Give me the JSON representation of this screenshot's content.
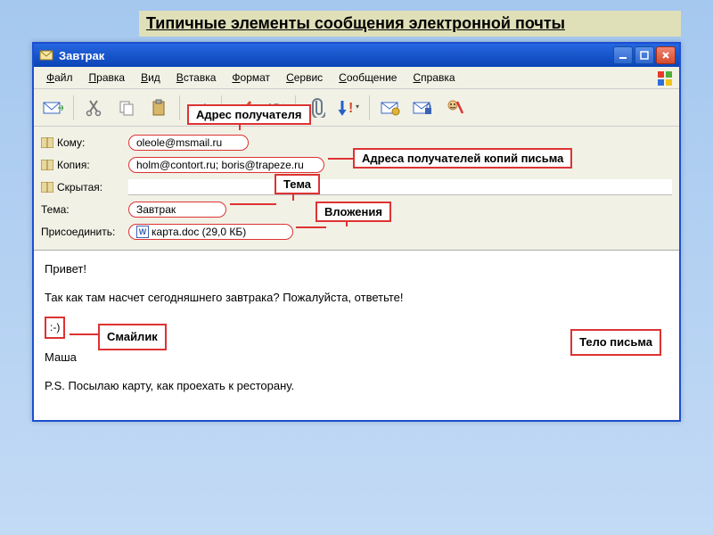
{
  "caption": "Типичные элементы сообщения электронной почты",
  "window": {
    "title": "Завтрак"
  },
  "menus": [
    "Файл",
    "Правка",
    "Вид",
    "Вставка",
    "Формат",
    "Сервис",
    "Сообщение",
    "Справка"
  ],
  "toolbar_icons": [
    "send",
    "cut",
    "copy",
    "paste",
    "undo",
    "check",
    "spell",
    "attach",
    "priority",
    "sign",
    "encrypt",
    "offline"
  ],
  "headers": {
    "to_label": "Кому:",
    "to_value": "oleole@msmail.ru",
    "cc_label": "Копия:",
    "cc_value": "holm@contort.ru; boris@trapeze.ru",
    "bcc_label": "Скрытая:",
    "bcc_value": "",
    "subject_label": "Тема:",
    "subject_value": "Завтрак",
    "attach_label": "Присоединить:",
    "attach_value": "карта.doc (29,0 КБ)"
  },
  "callouts": {
    "recipient": "Адрес получателя",
    "cc": "Адреса получателей копий письма",
    "subject": "Тема",
    "attachment": "Вложения",
    "smiley": "Смайлик",
    "body": "Тело письма"
  },
  "body": {
    "greeting": "Привет!",
    "line1": "Так как там насчет сегодняшнего завтрака? Пожалуйста, ответьте!",
    "smiley": ":-)",
    "sign": "Маша",
    "ps": "P.S. Посылаю карту, как проехать к ресторану."
  }
}
